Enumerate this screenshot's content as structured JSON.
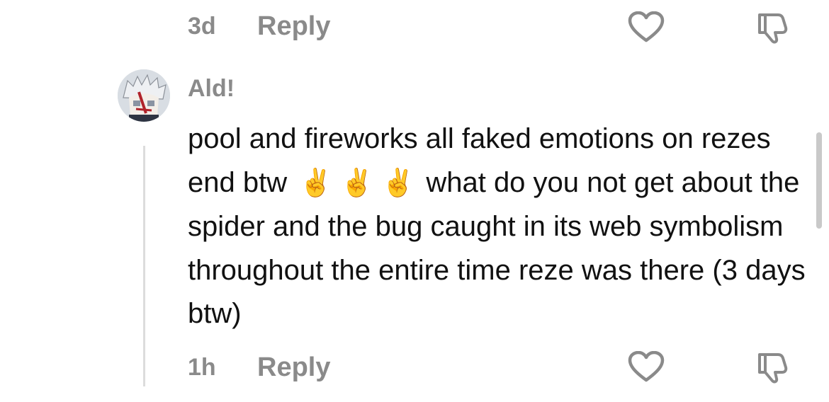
{
  "top_comment": {
    "time": "3d",
    "reply_label": "Reply",
    "like_icon": "heart-outline-icon",
    "dislike_icon": "thumbs-down-icon"
  },
  "reply_comment": {
    "username": "Ald!",
    "text_parts": [
      "pool and fireworks all faked emotions on rezes end btw ",
      "✌️",
      "✌️",
      "✌️",
      " what do you not get about the spider and the bug caught in its web symbolism throughout the entire time reze was there (3 days btw)"
    ],
    "time": "1h",
    "reply_label": "Reply",
    "like_icon": "heart-outline-icon",
    "dislike_icon": "thumbs-down-icon"
  },
  "colors": {
    "meta_text": "#8a8a8a",
    "body_text": "#111111",
    "thread_line": "#dcdcdc",
    "icon_stroke": "#8a8a8a"
  }
}
